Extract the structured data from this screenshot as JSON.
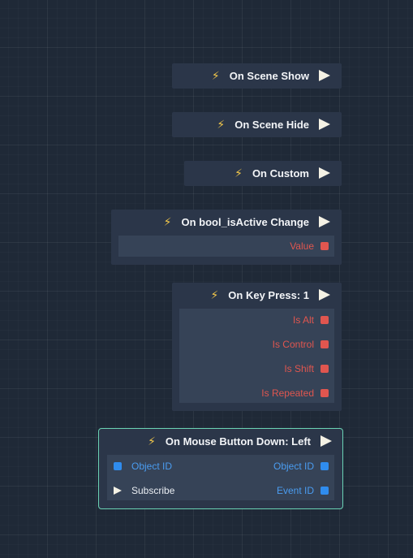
{
  "nodes": {
    "scene_show": {
      "title": "On Scene Show"
    },
    "scene_hide": {
      "title": "On Scene Hide"
    },
    "custom": {
      "title": "On Custom"
    },
    "bool_change": {
      "title": "On bool_isActive Change",
      "outputs": [
        "Value"
      ]
    },
    "key_press": {
      "title": "On Key Press: 1",
      "outputs": [
        "Is Alt",
        "Is Control",
        "Is Shift",
        "Is Repeated"
      ]
    },
    "mouse_down": {
      "title": "On Mouse Button Down: Left",
      "inputs": [
        "Object ID",
        "Subscribe"
      ],
      "outputs": [
        "Object ID",
        "Event ID"
      ]
    }
  },
  "colors": {
    "canvas": "#1f2937",
    "node": "#2b3649",
    "node_body": "#364357",
    "event_icon": "#f3c84a",
    "bool_pin": "#e0564f",
    "id_pin": "#2f8cee",
    "exec_pin": "#f4f1e4",
    "selection": "#6ad2b4"
  },
  "icons": {
    "event": "lightning-bolt-icon",
    "exec": "exec-triangle-icon"
  }
}
